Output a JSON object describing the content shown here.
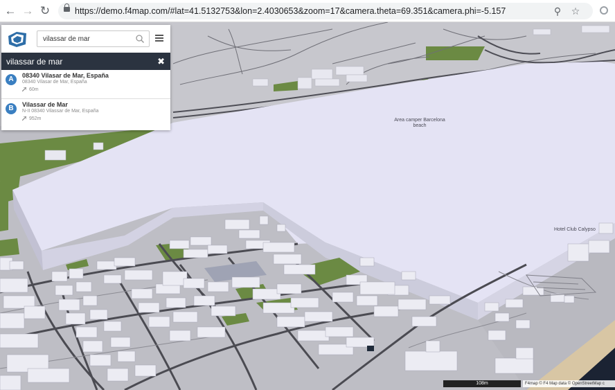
{
  "browser": {
    "url": "https://demo.f4map.com/#lat=41.5132753&lon=2.4030653&zoom=17&camera.theta=69.351&camera.phi=-5.157",
    "back_icon": "arrow-left-icon",
    "forward_icon": "arrow-right-icon",
    "reload_icon": "reload-icon",
    "zoom_icon": "magnifier-icon",
    "bookmark_icon": "star-icon"
  },
  "search": {
    "value": "vilassar de mar",
    "header_query": "vilassar de mar",
    "close_label": "✖"
  },
  "results": [
    {
      "marker": "A",
      "title": "08340 Vilasar de Mar, España",
      "subtitle": "08340 Vilasar de Mar, España",
      "distance": "60m"
    },
    {
      "marker": "B",
      "title": "Vilassar de Mar",
      "subtitle": "N-II 08340 Vilassar de Mar, España",
      "distance": "952m"
    }
  ],
  "map": {
    "labels": {
      "camper_line1": "Area camper Barcelona",
      "camper_line2": "beach",
      "hotel": "Hotel Club Calypso"
    },
    "scale": "108m",
    "attribution": "F4map © F4   Map data © OpenStreetMap c"
  },
  "colors": {
    "building": "#e9e9f1",
    "roof_big": "#e4e3f4",
    "park": "#6b8a43",
    "road": "#4b4b52",
    "ground": "#bdbdc4",
    "sea": "#1b2333",
    "sand": "#d8c6a4",
    "panel_header": "#2b3340",
    "marker": "#3a7fc1"
  }
}
